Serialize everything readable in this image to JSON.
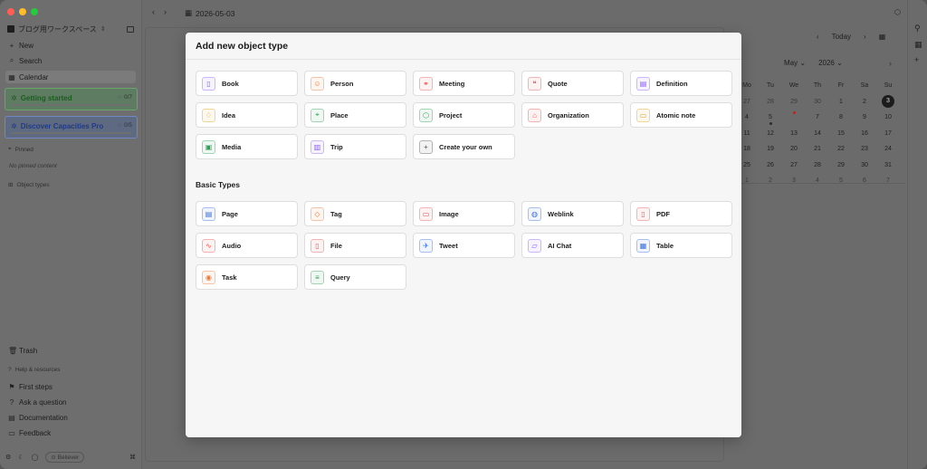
{
  "window": {
    "date": "2026-05-03"
  },
  "sidebar": {
    "workspace": "ブログ用ワークスペース",
    "nav": [
      {
        "label": "New",
        "icon": "plus-icon"
      },
      {
        "label": "Search",
        "icon": "search-icon"
      },
      {
        "label": "Calendar",
        "icon": "calendar-icon"
      }
    ],
    "cards": [
      {
        "title": "Getting started",
        "count": "0/7"
      },
      {
        "title": "Discover Capacities Pro",
        "count": "0/5"
      }
    ],
    "pinned_header": "Pinned",
    "pinned_empty": "No pinned content",
    "object_types_header": "Object types",
    "trash": "Trash",
    "help_header": "Help & resources",
    "help_items": [
      "First steps",
      "Ask a question",
      "Documentation",
      "Feedback"
    ],
    "badge": "Believer"
  },
  "calendar": {
    "today_label": "Today",
    "month": "May",
    "year": "2026",
    "weekdays": [
      "Mo",
      "Tu",
      "We",
      "Th",
      "Fr",
      "Sa",
      "Su"
    ],
    "weeks": [
      [
        "27",
        "28",
        "29",
        "30",
        "1",
        "2",
        "3"
      ],
      [
        "4",
        "5",
        "6",
        "7",
        "8",
        "9",
        "10"
      ],
      [
        "11",
        "12",
        "13",
        "14",
        "15",
        "16",
        "17"
      ],
      [
        "18",
        "19",
        "20",
        "21",
        "22",
        "23",
        "24"
      ],
      [
        "25",
        "26",
        "27",
        "28",
        "29",
        "30",
        "31"
      ],
      [
        "1",
        "2",
        "3",
        "4",
        "5",
        "6",
        "7"
      ]
    ]
  },
  "modal": {
    "title": "Add new object type",
    "templates": [
      {
        "label": "Book",
        "icon": "book-icon",
        "color": "#8b5cf6"
      },
      {
        "label": "Person",
        "icon": "person-icon",
        "color": "#ea7a3b"
      },
      {
        "label": "Meeting",
        "icon": "meeting-icon",
        "color": "#e05656"
      },
      {
        "label": "Quote",
        "icon": "quote-icon",
        "color": "#e05656"
      },
      {
        "label": "Definition",
        "icon": "definition-icon",
        "color": "#8b5cf6"
      },
      {
        "label": "Idea",
        "icon": "lightbulb-icon",
        "color": "#d9a520"
      },
      {
        "label": "Place",
        "icon": "map-pin-icon",
        "color": "#2f9e57"
      },
      {
        "label": "Project",
        "icon": "cube-icon",
        "color": "#2f9e57"
      },
      {
        "label": "Organization",
        "icon": "building-icon",
        "color": "#e05656"
      },
      {
        "label": "Atomic note",
        "icon": "atomic-note-icon",
        "color": "#d9a520"
      },
      {
        "label": "Media",
        "icon": "media-icon",
        "color": "#2f9e57"
      },
      {
        "label": "Trip",
        "icon": "luggage-icon",
        "color": "#8b5cf6"
      },
      {
        "label": "Create your own",
        "icon": "plus-icon",
        "color": "#555555"
      }
    ],
    "basic_header": "Basic Types",
    "basic": [
      {
        "label": "Page",
        "icon": "page-icon",
        "color": "#3b6fd9"
      },
      {
        "label": "Tag",
        "icon": "tag-icon",
        "color": "#ea7a3b"
      },
      {
        "label": "Image",
        "icon": "image-icon",
        "color": "#e05656"
      },
      {
        "label": "Weblink",
        "icon": "globe-icon",
        "color": "#3b6fd9"
      },
      {
        "label": "PDF",
        "icon": "pdf-icon",
        "color": "#e05656"
      },
      {
        "label": "Audio",
        "icon": "audio-icon",
        "color": "#e05656"
      },
      {
        "label": "File",
        "icon": "file-icon",
        "color": "#e05656"
      },
      {
        "label": "Tweet",
        "icon": "twitter-icon",
        "color": "#3b6fd9"
      },
      {
        "label": "AI Chat",
        "icon": "ai-chat-icon",
        "color": "#8b5cf6"
      },
      {
        "label": "Table",
        "icon": "table-icon",
        "color": "#3b6fd9"
      },
      {
        "label": "Task",
        "icon": "task-icon",
        "color": "#ea7a3b"
      },
      {
        "label": "Query",
        "icon": "query-icon",
        "color": "#2f9e57"
      }
    ]
  }
}
